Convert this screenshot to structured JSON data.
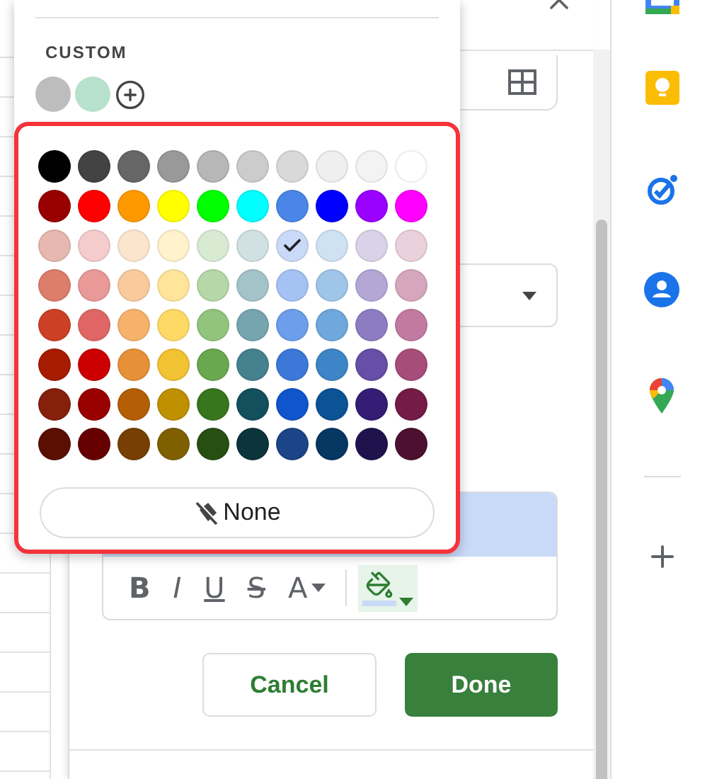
{
  "custom": {
    "label": "CUSTOM",
    "colors": [
      {
        "color": "#bdbdbd"
      },
      {
        "color": "#b7e1cd"
      }
    ]
  },
  "palette": [
    [
      {
        "color": "#000000",
        "selected": false
      },
      {
        "color": "#434343",
        "selected": false
      },
      {
        "color": "#666666",
        "selected": false
      },
      {
        "color": "#999999",
        "selected": false
      },
      {
        "color": "#b7b7b7",
        "selected": false
      },
      {
        "color": "#cccccc",
        "selected": false
      },
      {
        "color": "#d9d9d9",
        "selected": false
      },
      {
        "color": "#efefef",
        "selected": false
      },
      {
        "color": "#f3f3f3",
        "selected": false
      },
      {
        "color": "#ffffff",
        "selected": false
      }
    ],
    [
      {
        "color": "#980000",
        "selected": false
      },
      {
        "color": "#ff0000",
        "selected": false
      },
      {
        "color": "#ff9900",
        "selected": false
      },
      {
        "color": "#ffff00",
        "selected": false
      },
      {
        "color": "#00ff00",
        "selected": false
      },
      {
        "color": "#00ffff",
        "selected": false
      },
      {
        "color": "#4a86e8",
        "selected": false
      },
      {
        "color": "#0000ff",
        "selected": false
      },
      {
        "color": "#9900ff",
        "selected": false
      },
      {
        "color": "#ff00ff",
        "selected": false
      }
    ],
    [
      {
        "color": "#e6b8af",
        "selected": false
      },
      {
        "color": "#f4cccc",
        "selected": false
      },
      {
        "color": "#fce5cd",
        "selected": false
      },
      {
        "color": "#fff2cc",
        "selected": false
      },
      {
        "color": "#d9ead3",
        "selected": false
      },
      {
        "color": "#d0e0e3",
        "selected": false
      },
      {
        "color": "#c9daf8",
        "selected": true
      },
      {
        "color": "#cfe2f3",
        "selected": false
      },
      {
        "color": "#d9d2e9",
        "selected": false
      },
      {
        "color": "#ead1dc",
        "selected": false
      }
    ],
    [
      {
        "color": "#dd7e6b",
        "selected": false
      },
      {
        "color": "#ea9999",
        "selected": false
      },
      {
        "color": "#f9cb9c",
        "selected": false
      },
      {
        "color": "#ffe599",
        "selected": false
      },
      {
        "color": "#b6d7a8",
        "selected": false
      },
      {
        "color": "#a2c4c9",
        "selected": false
      },
      {
        "color": "#a4c2f4",
        "selected": false
      },
      {
        "color": "#9fc5e8",
        "selected": false
      },
      {
        "color": "#b4a7d6",
        "selected": false
      },
      {
        "color": "#d5a6bd",
        "selected": false
      }
    ],
    [
      {
        "color": "#cc4125",
        "selected": false
      },
      {
        "color": "#e06666",
        "selected": false
      },
      {
        "color": "#f6b26b",
        "selected": false
      },
      {
        "color": "#ffd966",
        "selected": false
      },
      {
        "color": "#93c47d",
        "selected": false
      },
      {
        "color": "#76a5af",
        "selected": false
      },
      {
        "color": "#6d9eeb",
        "selected": false
      },
      {
        "color": "#6fa8dc",
        "selected": false
      },
      {
        "color": "#8e7cc3",
        "selected": false
      },
      {
        "color": "#c27ba0",
        "selected": false
      }
    ],
    [
      {
        "color": "#a61c00",
        "selected": false
      },
      {
        "color": "#cc0000",
        "selected": false
      },
      {
        "color": "#e69138",
        "selected": false
      },
      {
        "color": "#f1c232",
        "selected": false
      },
      {
        "color": "#6aa84f",
        "selected": false
      },
      {
        "color": "#45818e",
        "selected": false
      },
      {
        "color": "#3c78d8",
        "selected": false
      },
      {
        "color": "#3d85c6",
        "selected": false
      },
      {
        "color": "#674ea7",
        "selected": false
      },
      {
        "color": "#a64d79",
        "selected": false
      }
    ],
    [
      {
        "color": "#85200c",
        "selected": false
      },
      {
        "color": "#990000",
        "selected": false
      },
      {
        "color": "#b45f06",
        "selected": false
      },
      {
        "color": "#bf9000",
        "selected": false
      },
      {
        "color": "#38761d",
        "selected": false
      },
      {
        "color": "#134f5c",
        "selected": false
      },
      {
        "color": "#1155cc",
        "selected": false
      },
      {
        "color": "#0b5394",
        "selected": false
      },
      {
        "color": "#351c75",
        "selected": false
      },
      {
        "color": "#741b47",
        "selected": false
      }
    ],
    [
      {
        "color": "#5b0f00",
        "selected": false
      },
      {
        "color": "#660000",
        "selected": false
      },
      {
        "color": "#783f04",
        "selected": false
      },
      {
        "color": "#7f6000",
        "selected": false
      },
      {
        "color": "#274e13",
        "selected": false
      },
      {
        "color": "#0c343d",
        "selected": false
      },
      {
        "color": "#1c4587",
        "selected": false
      },
      {
        "color": "#073763",
        "selected": false
      },
      {
        "color": "#20124d",
        "selected": false
      },
      {
        "color": "#4c1130",
        "selected": false
      }
    ]
  ],
  "none_button": {
    "label": "None"
  },
  "toolbar": [
    {
      "kind": "bold",
      "label": "B"
    },
    {
      "kind": "italic",
      "label": "I"
    },
    {
      "kind": "underline",
      "label": "U"
    },
    {
      "kind": "strike",
      "label": "S"
    },
    {
      "kind": "text-color",
      "label": "A"
    },
    {
      "kind": "fill-color"
    }
  ],
  "buttons": [
    {
      "kind": "secondary",
      "label": "Cancel"
    },
    {
      "kind": "primary",
      "label": "Done"
    }
  ]
}
